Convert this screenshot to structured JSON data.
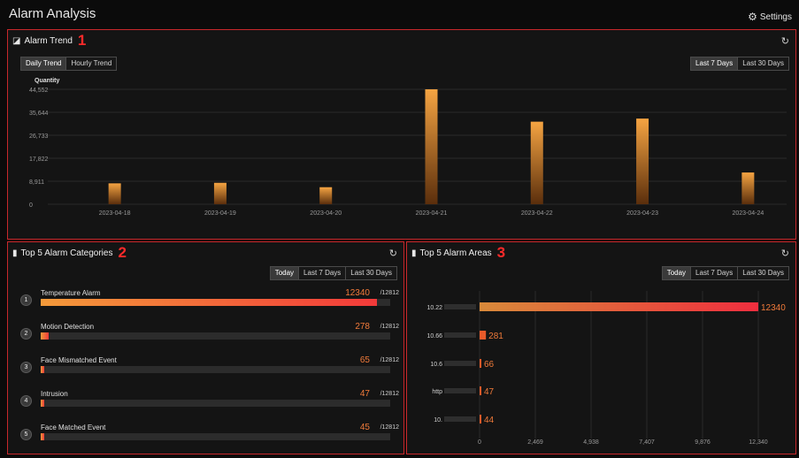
{
  "app": {
    "title": "Alarm Analysis",
    "settings_label": "Settings"
  },
  "panels": {
    "trend": {
      "title": "Alarm Trend",
      "number": "1",
      "tabs": [
        "Daily Trend",
        "Hourly Trend"
      ],
      "ranges": [
        "Last 7 Days",
        "Last 30 Days"
      ]
    },
    "categories": {
      "title": "Top 5 Alarm Categories",
      "number": "2",
      "ranges": [
        "Today",
        "Last 7 Days",
        "Last 30 Days"
      ],
      "items": [
        {
          "rank": "1",
          "name": "Temperature Alarm",
          "value": "12340",
          "total": "/12812",
          "fraction": 0.963
        },
        {
          "rank": "2",
          "name": "Motion Detection",
          "value": "278",
          "total": "/12812",
          "fraction": 0.022
        },
        {
          "rank": "3",
          "name": "Face Mismatched Event",
          "value": "65",
          "total": "/12812",
          "fraction": 0.005
        },
        {
          "rank": "4",
          "name": "Intrusion",
          "value": "47",
          "total": "/12812",
          "fraction": 0.004
        },
        {
          "rank": "5",
          "name": "Face Matched Event",
          "value": "45",
          "total": "/12812",
          "fraction": 0.0035
        }
      ]
    },
    "areas": {
      "title": "Top 5 Alarm Areas",
      "number": "3",
      "ranges": [
        "Today",
        "Last 7 Days",
        "Last 30 Days"
      ]
    }
  },
  "colors": {
    "border": "#c8282b",
    "bar_top": "#f5a442",
    "bar_bottom": "#5a2e0c",
    "accent_value": "#f07a3a"
  },
  "chart_data": [
    {
      "type": "bar",
      "title": "Alarm Trend",
      "ylabel": "Quantity",
      "categories": [
        "2023-04-18",
        "2023-04-19",
        "2023-04-20",
        "2023-04-21",
        "2023-04-22",
        "2023-04-23",
        "2023-04-24"
      ],
      "values": [
        8100,
        8300,
        6600,
        44552,
        32000,
        33200,
        12300
      ],
      "yticks": [
        "0",
        "8,911",
        "17,822",
        "26,733",
        "35,644",
        "44,552"
      ],
      "ylim": [
        0,
        44552
      ],
      "grid": true
    },
    {
      "type": "bar",
      "orientation": "horizontal",
      "title": "Top 5 Alarm Areas",
      "categories": [
        "10.22",
        "10.66",
        "10.6",
        "http",
        "10."
      ],
      "values": [
        12340,
        281,
        66,
        47,
        44
      ],
      "value_labels": [
        "12340",
        "281",
        "66",
        "47",
        "44"
      ],
      "xticks": [
        "0",
        "2,469",
        "4,938",
        "7,407",
        "9,876",
        "12,340"
      ],
      "xlim": [
        0,
        12340
      ],
      "grid": true
    }
  ]
}
